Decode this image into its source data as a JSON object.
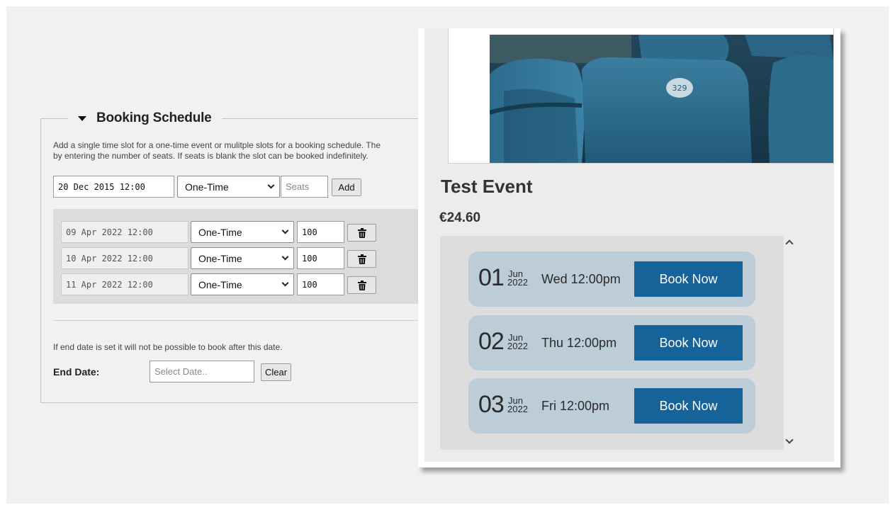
{
  "schedule": {
    "legend_title": "Booking Schedule",
    "description_line1": "Add a single time slot for a one-time event or mulitple slots for a booking schedule. The",
    "description_line2": "by entering the number of seats. If seats is blank the slot can be booked indefinitely.",
    "new_slot": {
      "date_value": "20 Dec 2015 12:00",
      "type_value": "One-Time",
      "seats_placeholder": "Seats",
      "add_label": "Add"
    },
    "slots": [
      {
        "date": "09 Apr 2022 12:00",
        "type": "One-Time",
        "seats": "100"
      },
      {
        "date": "10 Apr 2022 12:00",
        "type": "One-Time",
        "seats": "100"
      },
      {
        "date": "11 Apr 2022 12:00",
        "type": "One-Time",
        "seats": "100"
      }
    ],
    "end_note": "If end date is set it will not be possible to book after this date.",
    "end_date_label": "End Date:",
    "end_date_placeholder": "Select Date..",
    "clear_label": "Clear"
  },
  "event": {
    "title": "Test Event",
    "price": "€24.60",
    "seat_number_on_photo": "329",
    "dates": [
      {
        "day": "01",
        "month": "Jun",
        "year": "2022",
        "time": "Wed 12:00pm",
        "book_label": "Book Now"
      },
      {
        "day": "02",
        "month": "Jun",
        "year": "2022",
        "time": "Thu 12:00pm",
        "book_label": "Book Now"
      },
      {
        "day": "03",
        "month": "Jun",
        "year": "2022",
        "time": "Fri 12:00pm",
        "book_label": "Book Now"
      }
    ]
  },
  "colors": {
    "book_button": "#16639a",
    "slot_card": "#bccdd7",
    "seat_blue": "#2f6f8f"
  },
  "icons": {
    "delete": "trash-icon",
    "collapse": "caret-down-icon",
    "scroll_up": "chevron-up-icon",
    "scroll_down": "chevron-down-icon"
  }
}
